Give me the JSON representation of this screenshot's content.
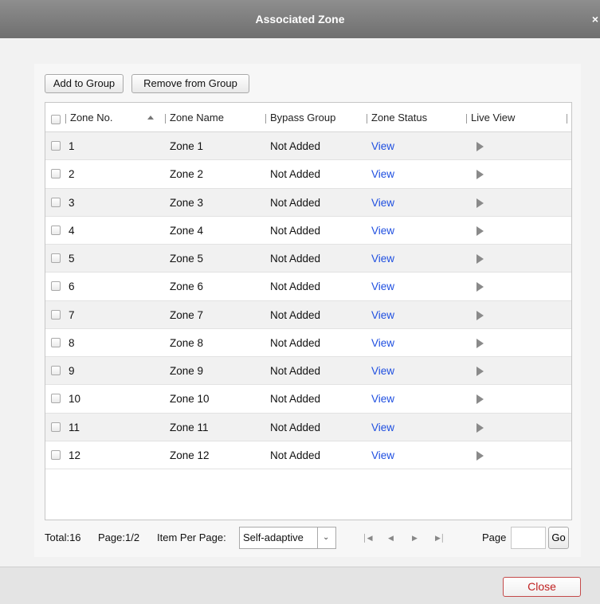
{
  "window": {
    "title": "Associated Zone",
    "close_glyph": "×"
  },
  "toolbar": {
    "add_label": "Add to Group",
    "remove_label": "Remove from Group"
  },
  "table": {
    "headers": {
      "zone_no": "Zone No.",
      "zone_name": "Zone Name",
      "bypass_group": "Bypass Group",
      "zone_status": "Zone Status",
      "live_view": "Live View"
    },
    "rows": [
      {
        "no": "1",
        "name": "Zone 1",
        "bypass": "Not Added",
        "status": "View"
      },
      {
        "no": "2",
        "name": "Zone 2",
        "bypass": "Not Added",
        "status": "View"
      },
      {
        "no": "3",
        "name": "Zone 3",
        "bypass": "Not Added",
        "status": "View"
      },
      {
        "no": "4",
        "name": "Zone 4",
        "bypass": "Not Added",
        "status": "View"
      },
      {
        "no": "5",
        "name": "Zone 5",
        "bypass": "Not Added",
        "status": "View"
      },
      {
        "no": "6",
        "name": "Zone 6",
        "bypass": "Not Added",
        "status": "View"
      },
      {
        "no": "7",
        "name": "Zone 7",
        "bypass": "Not Added",
        "status": "View"
      },
      {
        "no": "8",
        "name": "Zone 8",
        "bypass": "Not Added",
        "status": "View"
      },
      {
        "no": "9",
        "name": "Zone 9",
        "bypass": "Not Added",
        "status": "View"
      },
      {
        "no": "10",
        "name": "Zone 10",
        "bypass": "Not Added",
        "status": "View"
      },
      {
        "no": "11",
        "name": "Zone 11",
        "bypass": "Not Added",
        "status": "View"
      },
      {
        "no": "12",
        "name": "Zone 12",
        "bypass": "Not Added",
        "status": "View"
      }
    ]
  },
  "footer": {
    "total_text": "Total:16",
    "page_text": "Page:1/2",
    "items_per_page_label": "Item Per Page:",
    "items_per_page_value": "Self-adaptive",
    "page_label": "Page",
    "page_input_value": "",
    "go_label": "Go"
  },
  "dialog": {
    "close_label": "Close"
  },
  "colors": {
    "title_bar": "#7f7f7f",
    "link": "#1f4fe0",
    "close_text": "#c02020",
    "row_alt": "#f1f1f1"
  },
  "icons": {
    "sort": "sort-ascending-icon",
    "live_view": "play-icon",
    "first": "first-page-icon",
    "prev": "previous-page-icon",
    "next": "next-page-icon",
    "last": "last-page-icon",
    "dropdown": "chevron-down-icon"
  }
}
